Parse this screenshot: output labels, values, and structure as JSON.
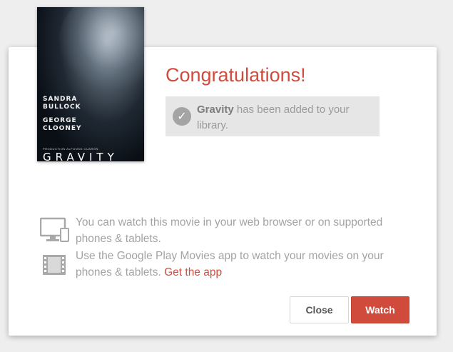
{
  "poster": {
    "actor1_first": "SANDRA",
    "actor1_last": "BULLOCK",
    "actor2_first": "GEORGE",
    "actor2_last": "CLOONEY",
    "credit": "PRODUCTION ALFONSO CUARÓN",
    "title": "GRAVITY"
  },
  "dialog": {
    "heading": "Congratulations!",
    "added_movie": "Gravity",
    "added_suffix": " has been added to your library.",
    "info_browser": "You can watch this movie in your web browser or on supported phones & tablets.",
    "info_app": "Use the Google Play Movies app to watch your movies on your phones & tablets. ",
    "get_app_link": "Get the app",
    "close_label": "Close",
    "watch_label": "Watch"
  },
  "colors": {
    "accent": "#d14b3d",
    "muted_text": "#a3a3a3",
    "added_bg": "#e6e6e6"
  },
  "icons": {
    "added": "check-circle-icon",
    "browser": "monitor-phone-icon",
    "app": "film-strip-icon"
  }
}
